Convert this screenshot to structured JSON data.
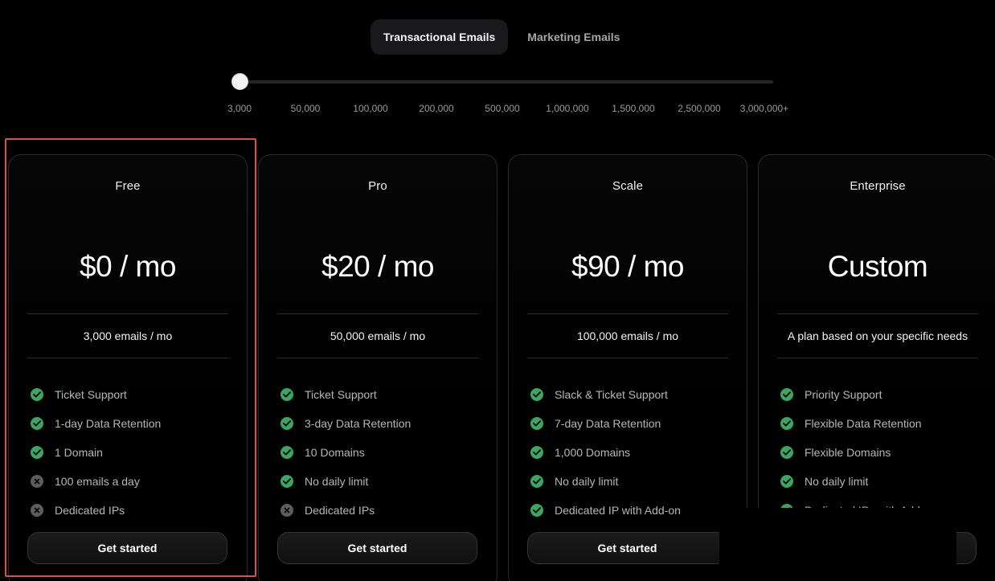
{
  "tabs": [
    {
      "label": "Transactional Emails",
      "active": true
    },
    {
      "label": "Marketing Emails",
      "active": false
    }
  ],
  "slider": {
    "selected_index": 0,
    "ticks": [
      "3,000",
      "50,000",
      "100,000",
      "200,000",
      "500,000",
      "1,000,000",
      "1,500,000",
      "2,500,000",
      "3,000,000+"
    ]
  },
  "plans": [
    {
      "title": "Free",
      "price": "$0 / mo",
      "volume": "3,000 emails / mo",
      "cta": "Get started",
      "features": [
        {
          "text": "Ticket Support",
          "included": true
        },
        {
          "text": "1-day Data Retention",
          "included": true
        },
        {
          "text": "1 Domain",
          "included": true
        },
        {
          "text": "100 emails a day",
          "included": false
        },
        {
          "text": "Dedicated IPs",
          "included": false
        }
      ]
    },
    {
      "title": "Pro",
      "price": "$20 / mo",
      "volume": "50,000 emails / mo",
      "cta": "Get started",
      "features": [
        {
          "text": "Ticket Support",
          "included": true
        },
        {
          "text": "3-day Data Retention",
          "included": true
        },
        {
          "text": "10 Domains",
          "included": true
        },
        {
          "text": "No daily limit",
          "included": true
        },
        {
          "text": "Dedicated IPs",
          "included": false
        }
      ]
    },
    {
      "title": "Scale",
      "price": "$90 / mo",
      "volume": "100,000 emails / mo",
      "cta": "Get started",
      "features": [
        {
          "text": "Slack & Ticket Support",
          "included": true
        },
        {
          "text": "7-day Data Retention",
          "included": true
        },
        {
          "text": "1,000 Domains",
          "included": true
        },
        {
          "text": "No daily limit",
          "included": true
        },
        {
          "text": "Dedicated IP with Add-on",
          "included": true
        }
      ]
    },
    {
      "title": "Enterprise",
      "price": "Custom",
      "volume": "A plan based on your specific needs",
      "cta": "",
      "features": [
        {
          "text": "Priority Support",
          "included": true
        },
        {
          "text": "Flexible Data Retention",
          "included": true
        },
        {
          "text": "Flexible Domains",
          "included": true
        },
        {
          "text": "No daily limit",
          "included": true
        },
        {
          "text": "Dedicated IPs with Add-on",
          "included": true
        }
      ]
    }
  ],
  "colors": {
    "check": "#3aa661",
    "cross": "#5d5d5f",
    "highlight": "#d9514c"
  }
}
